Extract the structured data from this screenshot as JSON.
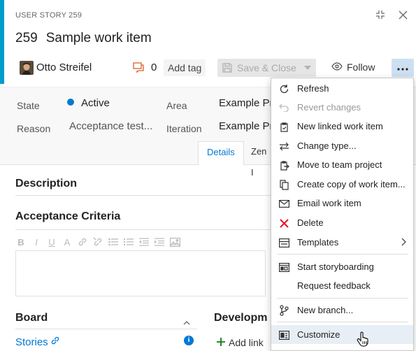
{
  "header": {
    "type_label": "USER STORY 259",
    "id": "259",
    "title": "Sample work item",
    "author": "Otto Streifel",
    "comment_count": "0",
    "add_tag_label": "Add tag",
    "save_close_label": "Save & Close",
    "follow_label": "Follow",
    "accent_color": "#009ccc"
  },
  "fields": {
    "state_label": "State",
    "state_value": "Active",
    "reason_label": "Reason",
    "reason_value": "Acceptance test...",
    "area_label": "Area",
    "area_value": "Example Pr",
    "iteration_label": "Iteration",
    "iteration_value": "Example Pr"
  },
  "tabs": [
    {
      "label": "Details"
    },
    {
      "label": "Zen I"
    }
  ],
  "sections": {
    "description": "Description",
    "acceptance": "Acceptance Criteria",
    "board": "Board",
    "development": "Developm",
    "stories_link": "Stories",
    "add_link": "Add link"
  },
  "menu": {
    "items": [
      {
        "label": "Refresh",
        "icon": "refresh-icon"
      },
      {
        "label": "Revert changes",
        "icon": "undo-icon",
        "disabled": true
      },
      {
        "label": "New linked work item",
        "icon": "new-linked-item-icon"
      },
      {
        "label": "Change type...",
        "icon": "swap-icon"
      },
      {
        "label": "Move to team project",
        "icon": "move-icon"
      },
      {
        "label": "Create copy of work item...",
        "icon": "copy-icon"
      },
      {
        "label": "Email work item",
        "icon": "mail-icon"
      },
      {
        "label": "Delete",
        "icon": "delete-icon"
      },
      {
        "label": "Templates",
        "icon": "templates-icon"
      },
      {
        "label": "Start storyboarding",
        "icon": "storyboard-icon"
      },
      {
        "label": "Request feedback",
        "icon": ""
      },
      {
        "label": "New branch...",
        "icon": "branch-icon"
      },
      {
        "label": "Customize",
        "icon": "customize-icon"
      }
    ]
  }
}
